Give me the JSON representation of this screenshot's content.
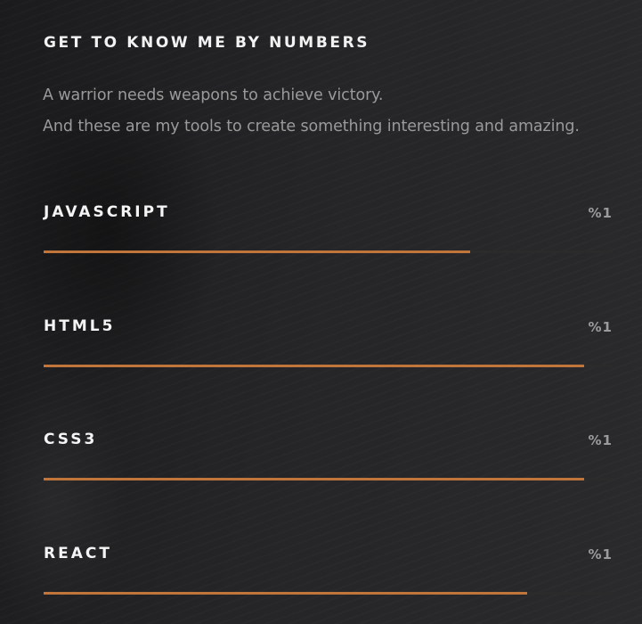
{
  "section": {
    "heading": "GET TO KNOW ME BY NUMBERS",
    "intro_line1": "A warrior needs weapons to achieve victory.",
    "intro_line2": "And these are my tools to create something interesting and amazing."
  },
  "skills": [
    {
      "name": "JAVASCRIPT",
      "percent_label": "%1",
      "level": 0.75
    },
    {
      "name": "HTML5",
      "percent_label": "%1",
      "level": 0.95
    },
    {
      "name": "CSS3",
      "percent_label": "%1",
      "level": 0.95
    },
    {
      "name": "REACT",
      "percent_label": "%1",
      "level": 0.85
    }
  ],
  "colors": {
    "accent": "#c0763a",
    "track": "#2c2b2b",
    "heading": "#f2f2f2",
    "muted_text": "#9a9a9a"
  }
}
